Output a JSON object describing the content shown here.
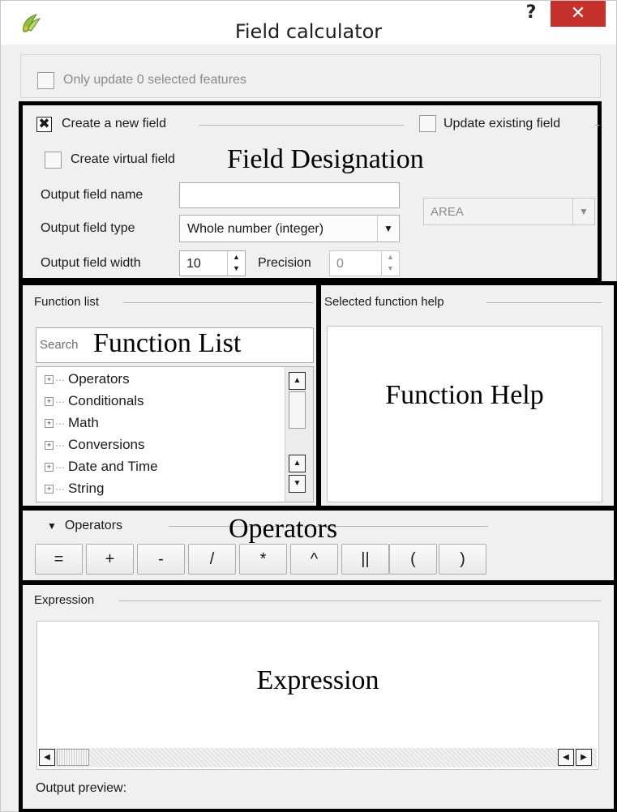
{
  "window": {
    "title": "Field calculator",
    "help_label": "?",
    "close_label": "✕",
    "icon": "qgis-icon"
  },
  "only_update": {
    "label": "Only update 0 selected features",
    "checked": false,
    "enabled": false
  },
  "field_designation": {
    "annotation": "Field Designation",
    "create_new_field": {
      "label": "Create a new field",
      "checked": true
    },
    "update_existing_field": {
      "label": "Update existing field",
      "checked": false,
      "field_value": "AREA"
    },
    "create_virtual_field": {
      "label": "Create virtual field",
      "checked": false
    },
    "output_field_name": {
      "label": "Output field name",
      "value": ""
    },
    "output_field_type": {
      "label": "Output field type",
      "value": "Whole number (integer)"
    },
    "output_field_width": {
      "label": "Output field width",
      "value": "10"
    },
    "precision": {
      "label": "Precision",
      "value": "0"
    }
  },
  "function_list": {
    "group_label": "Function list",
    "annotation": "Function List",
    "search_placeholder": "Search",
    "items": [
      "Operators",
      "Conditionals",
      "Math",
      "Conversions",
      "Date and Time",
      "String"
    ]
  },
  "function_help": {
    "group_label": "Selected function help",
    "annotation": "Function Help"
  },
  "operators": {
    "group_label": "Operators",
    "annotation": "Operators",
    "buttons": [
      "=",
      "+",
      "-",
      "/",
      "*",
      "^",
      "||",
      "(",
      ")"
    ]
  },
  "expression": {
    "group_label": "Expression",
    "annotation": "Expression",
    "output_preview_label": "Output preview:"
  },
  "colors": {
    "close_button": "#c7312b",
    "annotation_border": "#000000",
    "window_bg": "#f0f0f0"
  }
}
